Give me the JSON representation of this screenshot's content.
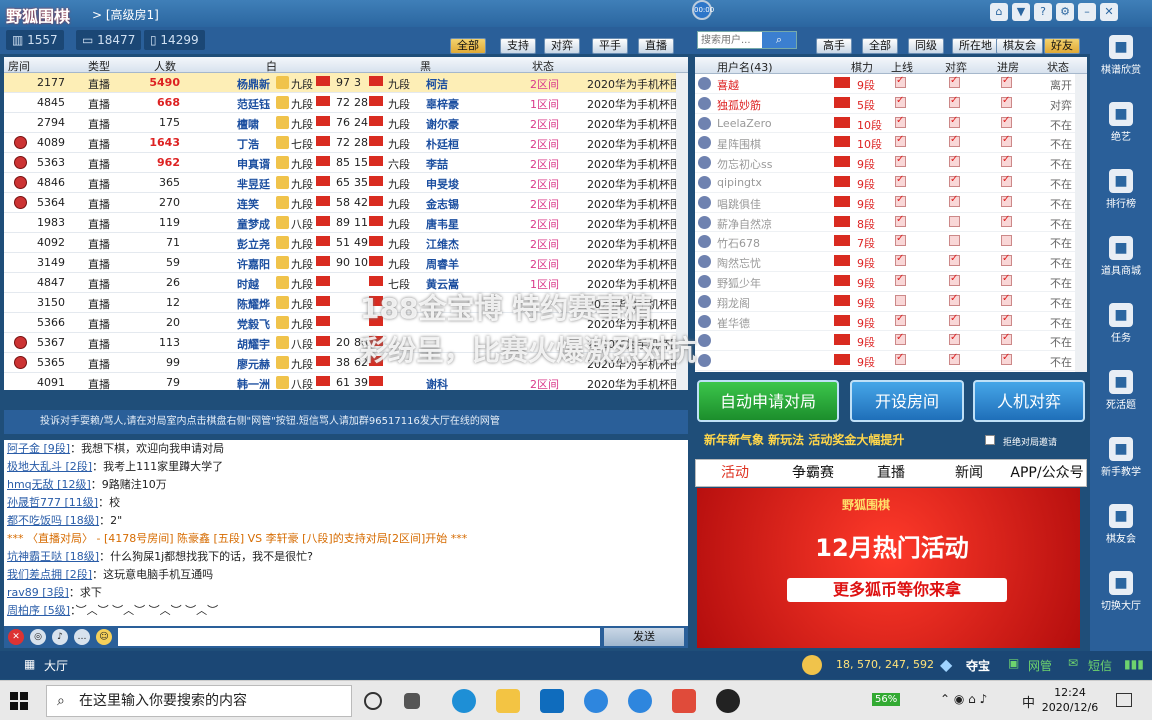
{
  "titlebar": {
    "logo": "野狐围棋",
    "breadcrumb": "> [高级房1]",
    "status_dot": "00:00",
    "icons": [
      "home-icon",
      "shirt-icon",
      "help-icon",
      "gear-icon",
      "minimize-icon",
      "close-icon"
    ]
  },
  "stats": {
    "online": "1557",
    "computers": "18477",
    "mobile": "14299"
  },
  "filters": [
    "全部",
    "支持",
    "对弈",
    "平手",
    "直播"
  ],
  "search": {
    "placeholder": "搜索用户...",
    "button": "搜索"
  },
  "user_filters": [
    "高手",
    "全部",
    "同级",
    "所在地",
    "棋友会",
    "好友"
  ],
  "room_table": {
    "headers": [
      "房间",
      "类型",
      "人数",
      "白",
      "黑",
      "状态"
    ],
    "rows": [
      {
        "room": "2177",
        "type": "直播",
        "count": "5490",
        "count_red": true,
        "white": "杨鼎新",
        "wrank": "九段",
        "wscore": "97",
        "bscore": "3",
        "brank": "九段",
        "black": "柯洁",
        "state": "2区间",
        "desc": "2020华为手机杯围",
        "tablet": false
      },
      {
        "room": "4845",
        "type": "直播",
        "count": "668",
        "count_red": true,
        "white": "范廷钰",
        "wrank": "九段",
        "wscore": "72",
        "bscore": "28",
        "brank": "九段",
        "black": "辜梓豪",
        "state": "1区间",
        "desc": "2020华为手机杯围",
        "tablet": false
      },
      {
        "room": "2794",
        "type": "直播",
        "count": "175",
        "count_red": false,
        "white": "檀啸",
        "wrank": "九段",
        "wscore": "76",
        "bscore": "24",
        "brank": "九段",
        "black": "谢尔豪",
        "state": "2区间",
        "desc": "2020华为手机杯围",
        "tablet": false
      },
      {
        "room": "4089",
        "type": "直播",
        "count": "1643",
        "count_red": true,
        "white": "丁浩",
        "wrank": "七段",
        "wscore": "72",
        "bscore": "28",
        "brank": "九段",
        "black": "朴廷桓",
        "state": "2区间",
        "desc": "2020华为手机杯围",
        "tablet": true
      },
      {
        "room": "5363",
        "type": "直播",
        "count": "962",
        "count_red": true,
        "white": "申真谞",
        "wrank": "九段",
        "wscore": "85",
        "bscore": "15",
        "brank": "六段",
        "black": "李喆",
        "state": "2区间",
        "desc": "2020华为手机杯围",
        "tablet": true
      },
      {
        "room": "4846",
        "type": "直播",
        "count": "365",
        "count_red": false,
        "white": "芈昱廷",
        "wrank": "九段",
        "wscore": "65",
        "bscore": "35",
        "brank": "九段",
        "black": "申旻埈",
        "state": "2区间",
        "desc": "2020华为手机杯围",
        "tablet": true
      },
      {
        "room": "5364",
        "type": "直播",
        "count": "270",
        "count_red": false,
        "white": "连笑",
        "wrank": "九段",
        "wscore": "58",
        "bscore": "42",
        "brank": "九段",
        "black": "金志锡",
        "state": "2区间",
        "desc": "2020华为手机杯围",
        "tablet": true
      },
      {
        "room": "1983",
        "type": "直播",
        "count": "119",
        "count_red": false,
        "white": "童梦成",
        "wrank": "八段",
        "wscore": "89",
        "bscore": "11",
        "brank": "九段",
        "black": "唐韦星",
        "state": "2区间",
        "desc": "2020华为手机杯围",
        "tablet": false
      },
      {
        "room": "4092",
        "type": "直播",
        "count": "71",
        "count_red": false,
        "white": "彭立尧",
        "wrank": "九段",
        "wscore": "51",
        "bscore": "49",
        "brank": "九段",
        "black": "江维杰",
        "state": "2区间",
        "desc": "2020华为手机杯围",
        "tablet": false
      },
      {
        "room": "3149",
        "type": "直播",
        "count": "59",
        "count_red": false,
        "white": "许嘉阳",
        "wrank": "九段",
        "wscore": "90",
        "bscore": "10",
        "brank": "九段",
        "black": "周睿羊",
        "state": "2区间",
        "desc": "2020华为手机杯围",
        "tablet": false
      },
      {
        "room": "4847",
        "type": "直播",
        "count": "26",
        "count_red": false,
        "white": "时越",
        "wrank": "九段",
        "wscore": "",
        "bscore": "",
        "brank": "七段",
        "black": "黄云嵩",
        "state": "1区间",
        "desc": "2020华为手机杯围",
        "tablet": false
      },
      {
        "room": "3150",
        "type": "直播",
        "count": "12",
        "count_red": false,
        "white": "陈耀烨",
        "wrank": "九段",
        "wscore": "",
        "bscore": "",
        "brank": "",
        "black": "",
        "state": "",
        "desc": "2020华为手机杯围",
        "tablet": false
      },
      {
        "room": "5366",
        "type": "直播",
        "count": "20",
        "count_red": false,
        "white": "党毅飞",
        "wrank": "九段",
        "wscore": "",
        "bscore": "",
        "brank": "",
        "black": "",
        "state": "",
        "desc": "2020华为手机杯围",
        "tablet": false
      },
      {
        "room": "5367",
        "type": "直播",
        "count": "113",
        "count_red": false,
        "white": "胡耀宇",
        "wrank": "八段",
        "wscore": "20",
        "bscore": "80",
        "brank": "",
        "black": "",
        "state": "",
        "desc": "2020华为手机杯围",
        "tablet": true
      },
      {
        "room": "5365",
        "type": "直播",
        "count": "99",
        "count_red": false,
        "white": "廖元赫",
        "wrank": "九段",
        "wscore": "38",
        "bscore": "62",
        "brank": "",
        "black": "",
        "state": "",
        "desc": "2020华为手机杯围",
        "tablet": true
      },
      {
        "room": "4091",
        "type": "直播",
        "count": "79",
        "count_red": false,
        "white": "韩一洲",
        "wrank": "八段",
        "wscore": "61",
        "bscore": "39",
        "brank": "",
        "black": "谢科",
        "state": "2区间",
        "desc": "2020华为手机杯围",
        "tablet": false
      }
    ]
  },
  "notice": "投诉对手耍赖/骂人,请在对局室内点击棋盘右侧\"网管\"按钮.短信骂人请加群96517116发大厅在线的网管",
  "chat": [
    {
      "nick": "阿子金 [9段]",
      "text": "：我想下棋，欢迎向我申请对局"
    },
    {
      "nick": "极地大乱斗 [2段]",
      "text": "：我考上111家里蹲大学了"
    },
    {
      "nick": "hmq无敌 [12级]",
      "text": "：9路赌注10万"
    },
    {
      "nick": "孙晟哲777 [11级]",
      "text": "：校"
    },
    {
      "nick": "都不吃饭吗 [18级]",
      "text": "：2\""
    },
    {
      "system": "*** 〈直播对局〉 - [4178号房间] 陈豪鑫 [五段] VS 李轩豪 [八段]的支持对局[2区间]开始 ***"
    },
    {
      "nick": "坑神霸王哒 [18级]",
      "text": "：什么狗屎1j都想找我下的话，我不是很忙?"
    },
    {
      "nick": "我们差点拥 [2段]",
      "text": "：这玩意电脑手机互通吗"
    },
    {
      "nick": "rav89 [3段]",
      "text": "：求下"
    },
    {
      "nick": "周柏序 [5级]",
      "text": "：︶︿︶  ︶︿︶  ︶︿︶  ︶︿︶"
    }
  ],
  "chat_send": "发送",
  "bottombar": {
    "hall": "大厅",
    "coins": "18, 570, 247, 592",
    "vip": "夺宝",
    "net": "网管",
    "sms": "短信"
  },
  "user_list": {
    "headers": [
      "用户名(43)",
      "棋力",
      "上线",
      "对弈",
      "进房",
      "状态"
    ],
    "rows": [
      {
        "name": "喜越",
        "rank": "9段",
        "online": true,
        "play": true,
        "room": true,
        "state": "离开",
        "red": true
      },
      {
        "name": "独孤妙筋",
        "rank": "5段",
        "online": true,
        "play": true,
        "room": true,
        "state": "对弈",
        "red": true
      },
      {
        "name": "LeelaZero",
        "rank": "10段",
        "online": true,
        "play": true,
        "room": true,
        "state": "不在",
        "red": false
      },
      {
        "name": "星阵围棋",
        "rank": "10段",
        "online": true,
        "play": true,
        "room": true,
        "state": "不在",
        "red": false
      },
      {
        "name": "勿忘初心ss",
        "rank": "9段",
        "online": true,
        "play": true,
        "room": true,
        "state": "不在",
        "red": false
      },
      {
        "name": "qipingtx",
        "rank": "9段",
        "online": true,
        "play": true,
        "room": true,
        "state": "不在",
        "red": false
      },
      {
        "name": "唱跳俱佳",
        "rank": "9段",
        "online": true,
        "play": true,
        "room": true,
        "state": "不在",
        "red": false
      },
      {
        "name": "薪净自然凉",
        "rank": "8段",
        "online": true,
        "play": false,
        "room": true,
        "state": "不在",
        "red": false
      },
      {
        "name": "竹石678",
        "rank": "7段",
        "online": true,
        "play": false,
        "room": false,
        "state": "不在",
        "red": false
      },
      {
        "name": "陶然忘忧",
        "rank": "9段",
        "online": true,
        "play": true,
        "room": true,
        "state": "不在",
        "red": false
      },
      {
        "name": "野狐少年",
        "rank": "9段",
        "online": true,
        "play": true,
        "room": true,
        "state": "不在",
        "red": false
      },
      {
        "name": "翔龙阁",
        "rank": "9段",
        "online": false,
        "play": true,
        "room": true,
        "state": "不在",
        "red": false
      },
      {
        "name": "崔华德",
        "rank": "9段",
        "online": true,
        "play": true,
        "room": true,
        "state": "不在",
        "red": false
      },
      {
        "name": "",
        "rank": "9段",
        "online": true,
        "play": true,
        "room": true,
        "state": "不在",
        "red": false
      },
      {
        "name": "",
        "rank": "9段",
        "online": true,
        "play": true,
        "room": true,
        "state": "不在",
        "red": false
      }
    ]
  },
  "buttons": {
    "auto": "自动申请对局",
    "open": "开设房间",
    "ai": "人机对弈"
  },
  "promo": "新年新气象 新玩法 活动奖金大幅提升",
  "reject_label": "拒绝对局邀请",
  "news_tabs": [
    "活动",
    "争霸赛",
    "直播",
    "新闻",
    "APP/公众号"
  ],
  "banner": {
    "logo": "野狐围棋",
    "title": "12月热门活动",
    "subtitle": "更多狐币等你来拿"
  },
  "sidebar": [
    {
      "label": "棋谱欣赏",
      "icon": "book-icon"
    },
    {
      "label": "绝艺",
      "icon": "ai-icon"
    },
    {
      "label": "排行榜",
      "icon": "ranking-icon"
    },
    {
      "label": "道具商城",
      "icon": "shop-icon"
    },
    {
      "label": "任务",
      "icon": "task-icon"
    },
    {
      "label": "死活题",
      "icon": "puzzle-icon"
    },
    {
      "label": "新手教学",
      "icon": "teach-icon"
    },
    {
      "label": "棋友会",
      "icon": "club-icon"
    },
    {
      "label": "切换大厅",
      "icon": "switch-icon"
    }
  ],
  "watermark": [
    "188金宝博 特约赛事精",
    "彩纷呈，比赛火爆激烈对抗"
  ],
  "taskbar": {
    "search": "在这里输入你要搜索的内容",
    "battery": "56%",
    "ime": "中",
    "time": "12:24",
    "date": "2020/12/6"
  }
}
